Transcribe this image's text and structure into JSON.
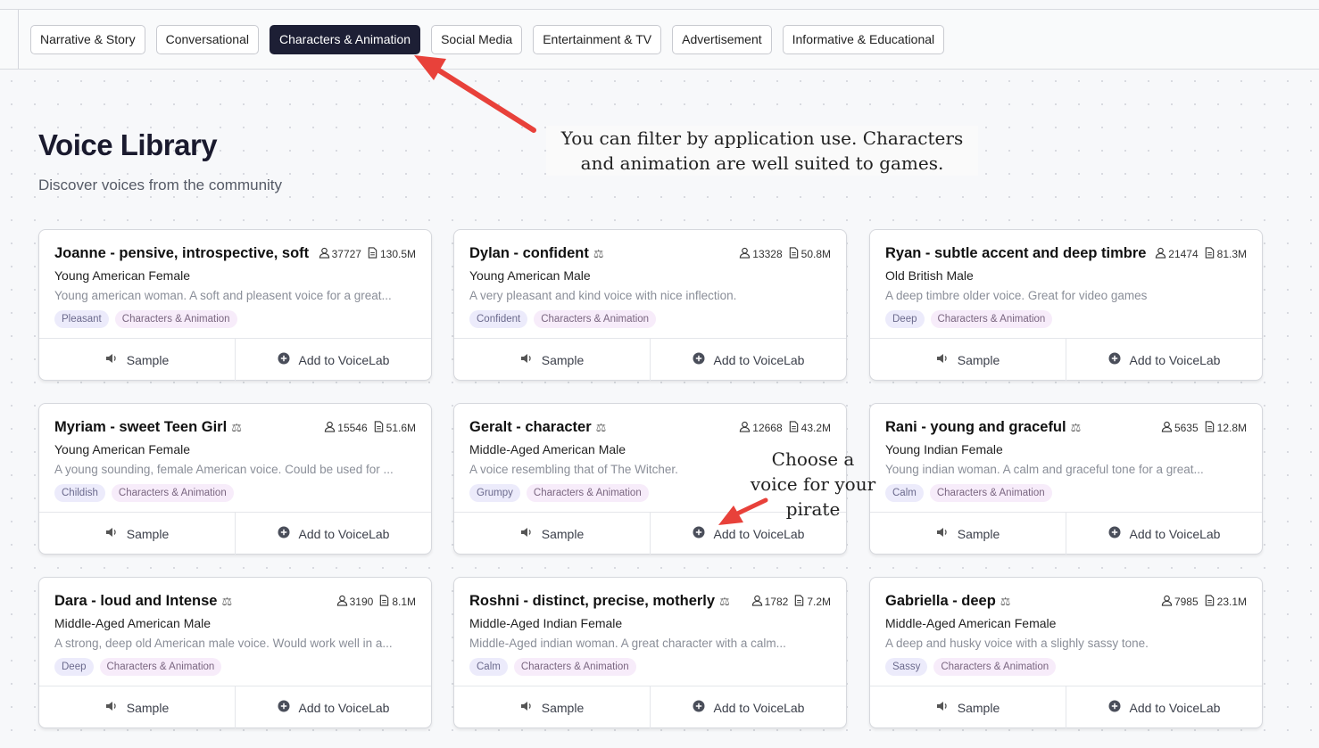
{
  "filters": [
    {
      "label": "Narrative & Story",
      "active": false
    },
    {
      "label": "Conversational",
      "active": false
    },
    {
      "label": "Characters & Animation",
      "active": true
    },
    {
      "label": "Social Media",
      "active": false
    },
    {
      "label": "Entertainment & TV",
      "active": false
    },
    {
      "label": "Advertisement",
      "active": false
    },
    {
      "label": "Informative & Educational",
      "active": false
    }
  ],
  "header": {
    "title": "Voice Library",
    "subtitle": "Discover voices from the community"
  },
  "annotations": {
    "filter_note": "You can filter by application use. Characters and animation are well suited to games.",
    "pirate_note": "Choose a voice for your pirate"
  },
  "actions": {
    "sample_label": "Sample",
    "add_label": "Add to VoiceLab"
  },
  "cards": [
    {
      "name": "Joanne - pensive, introspective, soft",
      "flask": false,
      "users": "37727",
      "chars": "130.5M",
      "meta": "Young American Female",
      "description": "Young american woman. A soft and pleasent voice for a great...",
      "tag": "Pleasant",
      "category": "Characters & Animation"
    },
    {
      "name": "Dylan - confident",
      "flask": true,
      "users": "13328",
      "chars": "50.8M",
      "meta": "Young American Male",
      "description": "A very pleasant and kind voice with nice inflection.",
      "tag": "Confident",
      "category": "Characters & Animation"
    },
    {
      "name": "Ryan - subtle accent and deep timbre",
      "flask": false,
      "users": "21474",
      "chars": "81.3M",
      "meta": "Old British Male",
      "description": "A deep timbre older voice. Great for video games",
      "tag": "Deep",
      "category": "Characters & Animation"
    },
    {
      "name": "Myriam - sweet Teen Girl",
      "flask": true,
      "users": "15546",
      "chars": "51.6M",
      "meta": "Young American Female",
      "description": "A young sounding, female American voice. Could be used for ...",
      "tag": "Childish",
      "category": "Characters & Animation"
    },
    {
      "name": "Geralt - character",
      "flask": true,
      "users": "12668",
      "chars": "43.2M",
      "meta": "Middle-Aged American Male",
      "description": "A voice resembling that of The Witcher.",
      "tag": "Grumpy",
      "category": "Characters & Animation"
    },
    {
      "name": "Rani - young and graceful",
      "flask": true,
      "users": "5635",
      "chars": "12.8M",
      "meta": "Young Indian Female",
      "description": "Young indian woman. A calm and graceful tone for a great...",
      "tag": "Calm",
      "category": "Characters & Animation"
    },
    {
      "name": "Dara - loud and Intense",
      "flask": true,
      "users": "3190",
      "chars": "8.1M",
      "meta": "Middle-Aged American Male",
      "description": "A strong, deep old American male voice. Would work well in a...",
      "tag": "Deep",
      "category": "Characters & Animation"
    },
    {
      "name": "Roshni - distinct, precise, motherly",
      "flask": true,
      "users": "1782",
      "chars": "7.2M",
      "meta": "Middle-Aged Indian Female",
      "description": "Middle-Aged indian woman. A great character with a calm...",
      "tag": "Calm",
      "category": "Characters & Animation"
    },
    {
      "name": "Gabriella - deep",
      "flask": true,
      "users": "7985",
      "chars": "23.1M",
      "meta": "Middle-Aged American Female",
      "description": "A deep and husky voice with a slighly sassy tone.",
      "tag": "Sassy",
      "category": "Characters & Animation"
    }
  ],
  "colors": {
    "active_filter_bg": "#1d1f35",
    "arrow": "#e8413a",
    "tag_bg": "#ecebfb",
    "category_bg": "#f7ecfa"
  }
}
